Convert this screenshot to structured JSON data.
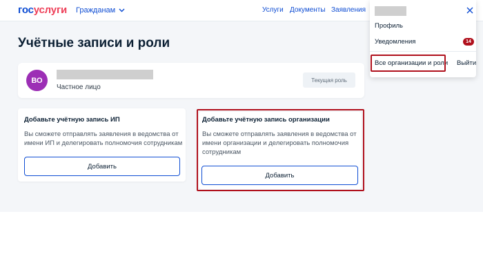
{
  "header": {
    "logo_part1": "гос",
    "logo_part2": "услуги",
    "citizens_label": "Гражданам",
    "nav": {
      "services": "Услуги",
      "documents": "Документы",
      "applications": "Заявления"
    }
  },
  "page": {
    "title": "Учётные записи и роли"
  },
  "profile": {
    "avatar_initials": "ВО",
    "subtitle": "Частное лицо",
    "current_role_label": "Текущая роль"
  },
  "cards": {
    "ip": {
      "title": "Добавьте учётную запись ИП",
      "desc_line1": "Вы сможете отправлять заявления в ведомства от",
      "desc_line2": "имени ИП и делегировать полномочия сотрудникам",
      "button": "Добавить"
    },
    "org": {
      "title": "Добавьте учётную запись организации",
      "desc_line1": "Вы сможете отправлять заявления в ведомства от",
      "desc_line2": "имени организации и делегировать полномочия",
      "desc_line3": "сотрудникам",
      "button": "Добавить"
    }
  },
  "dropdown": {
    "profile": "Профиль",
    "notifications": "Уведомления",
    "notifications_count": "14",
    "all_orgs": "Все организации и роли",
    "logout": "Выйти"
  },
  "colors": {
    "brand_blue": "#0d4cd3",
    "brand_red": "#ee3f58",
    "highlight": "#b0101c",
    "avatar": "#9c2eb5"
  },
  "icons": {
    "citizens": "chevron-down-icon",
    "close": "close-icon"
  }
}
